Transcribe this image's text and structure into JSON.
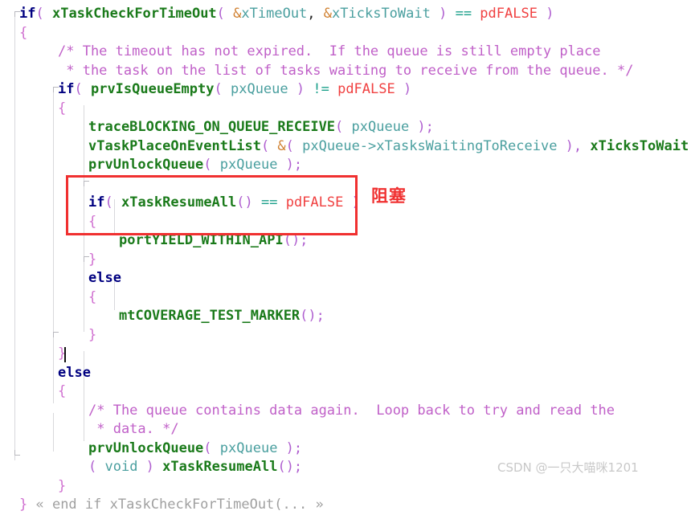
{
  "editor": {
    "background_color": "#ffffff",
    "language": "c",
    "caret_line": 18,
    "colors": {
      "keyword": "#000080",
      "function": "#1a7a1a",
      "variable": "#4a9f9f",
      "punctuation": "#b060d0",
      "operator": "#1aa08a",
      "ampersand": "#d08030",
      "constant": "#f04040",
      "comment": "#c060c8",
      "brace": "#d070d0",
      "fold_marker": "#a0a0a0",
      "highlight": "#f03030",
      "watermark": "#c8c8c8"
    }
  },
  "code_lines": [
    {
      "indent": 0,
      "text": "if( xTaskCheckForTimeOut( &xTimeOut, &xTicksToWait ) == pdFALSE )"
    },
    {
      "indent": 0,
      "text": "{"
    },
    {
      "indent": 1,
      "text": "/* The timeout has not expired.  If the queue is still empty place"
    },
    {
      "indent": 1,
      "text": " * the task on the list of tasks waiting to receive from the queue. */"
    },
    {
      "indent": 1,
      "text": "if( prvIsQueueEmpty( pxQueue ) != pdFALSE )"
    },
    {
      "indent": 1,
      "text": "{"
    },
    {
      "indent": 2,
      "text": "traceBLOCKING_ON_QUEUE_RECEIVE( pxQueue );"
    },
    {
      "indent": 2,
      "text": "vTaskPlaceOnEventList( &( pxQueue->xTasksWaitingToReceive ), xTicksToWait );"
    },
    {
      "indent": 2,
      "text": "prvUnlockQueue( pxQueue );"
    },
    {
      "indent": 2,
      "text": ""
    },
    {
      "indent": 2,
      "text": "if( xTaskResumeAll() == pdFALSE )"
    },
    {
      "indent": 2,
      "text": "{"
    },
    {
      "indent": 3,
      "text": "portYIELD_WITHIN_API();"
    },
    {
      "indent": 2,
      "text": "}"
    },
    {
      "indent": 2,
      "text": "else"
    },
    {
      "indent": 2,
      "text": "{"
    },
    {
      "indent": 3,
      "text": "mtCOVERAGE_TEST_MARKER();"
    },
    {
      "indent": 2,
      "text": "}"
    },
    {
      "indent": 1,
      "text": "}"
    },
    {
      "indent": 1,
      "text": "else"
    },
    {
      "indent": 1,
      "text": "{"
    },
    {
      "indent": 2,
      "text": "/* The queue contains data again.  Loop back to try and read the"
    },
    {
      "indent": 2,
      "text": " * data. */"
    },
    {
      "indent": 2,
      "text": "prvUnlockQueue( pxQueue );"
    },
    {
      "indent": 2,
      "text": "( void ) xTaskResumeAll();"
    },
    {
      "indent": 1,
      "text": "}"
    },
    {
      "indent": 0,
      "text": "} « end if xTaskCheckForTimeOut(... »"
    }
  ],
  "annotation": {
    "label": "阻塞",
    "color": "#f03030"
  },
  "highlight_box": {
    "label": "blocking-if-highlight",
    "color": "#f03030"
  },
  "watermark": {
    "text": "CSDN @一只大喵咪1201"
  },
  "fold_marker": {
    "open_guillemet": "«",
    "close_guillemet": "»",
    "text": "end if xTaskCheckForTimeOut(..."
  }
}
